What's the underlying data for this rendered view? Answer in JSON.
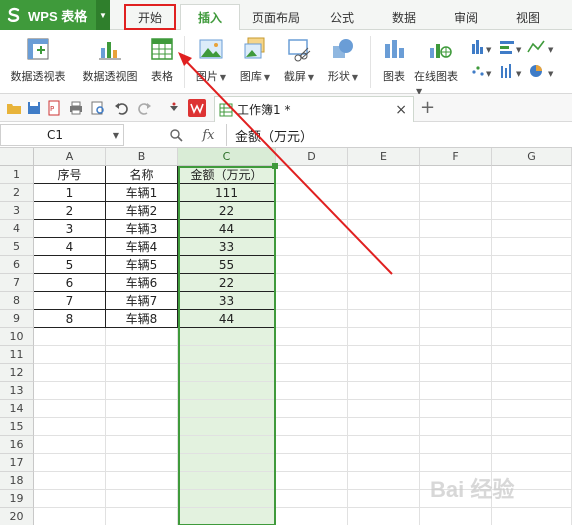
{
  "app": {
    "name": "WPS 表格"
  },
  "menu_tabs": [
    "开始",
    "插入",
    "页面布局",
    "公式",
    "数据",
    "审阅",
    "视图"
  ],
  "active_tab": "插入",
  "highlighted_tab": "开始",
  "ribbon": {
    "items": [
      {
        "label": "数据透视表",
        "icon": "pivot-table-icon"
      },
      {
        "label": "数据透视图",
        "icon": "pivot-chart-icon"
      },
      {
        "label": "表格",
        "icon": "table-icon"
      },
      {
        "label": "图片",
        "icon": "picture-icon",
        "dropdown": true
      },
      {
        "label": "图库",
        "icon": "gallery-icon",
        "dropdown": true
      },
      {
        "label": "截屏",
        "icon": "screenshot-icon",
        "dropdown": true
      },
      {
        "label": "形状",
        "icon": "shapes-icon",
        "dropdown": true
      },
      {
        "label": "图表",
        "icon": "chart-icon"
      },
      {
        "label": "在线图表",
        "icon": "online-chart-icon",
        "dropdown": true
      }
    ]
  },
  "document_tab": {
    "title": "工作簿1 *",
    "close": "×",
    "new": "+"
  },
  "formula_bar": {
    "cell_ref": "C1",
    "fx": "fx",
    "content": "金额（万元）"
  },
  "sheet": {
    "columns": [
      "A",
      "B",
      "C",
      "D",
      "E",
      "F",
      "G"
    ],
    "rows": [
      "1",
      "2",
      "3",
      "4",
      "5",
      "6",
      "7",
      "8",
      "9",
      "10",
      "11",
      "12",
      "13",
      "14",
      "15",
      "16",
      "17",
      "18",
      "19",
      "20"
    ],
    "selected_column": "C",
    "data": [
      [
        "序号",
        "名称",
        "金额（万元）"
      ],
      [
        "1",
        "车辆1",
        "111"
      ],
      [
        "2",
        "车辆2",
        "22"
      ],
      [
        "3",
        "车辆3",
        "44"
      ],
      [
        "4",
        "车辆4",
        "33"
      ],
      [
        "5",
        "车辆5",
        "55"
      ],
      [
        "6",
        "车辆6",
        "22"
      ],
      [
        "7",
        "车辆7",
        "33"
      ],
      [
        "8",
        "车辆8",
        "44"
      ]
    ]
  },
  "watermark": "Bai 经验",
  "colors": {
    "brand_green": "#3f9a3b",
    "annotation_red": "#e02020",
    "selection_fill": "#e3f2df"
  }
}
